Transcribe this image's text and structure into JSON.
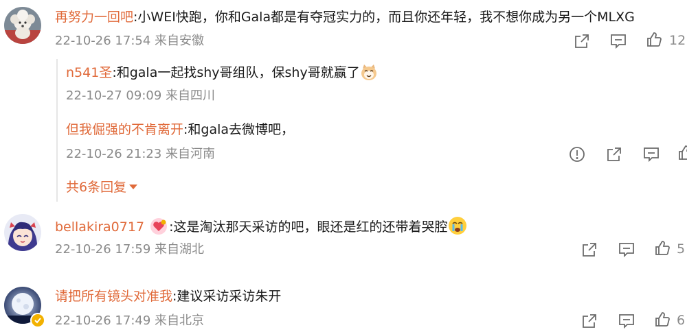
{
  "comments": [
    {
      "user": "再努力一回吧",
      "text": "小WEI快跑，你和Gala都是有夺冠实力的，而且你还年轻，我不想你成为另一个MLXG",
      "date": "22-10-26 17:54",
      "location": "来自安徽",
      "likes": "12",
      "avatar_icon": "poodle-avatar",
      "replies": [
        {
          "user": "n541圣",
          "text": "和gala一起找shy哥组队，保shy哥就赢了",
          "date": "22-10-27 09:09",
          "location": "来自四川",
          "emoji": "cat-emoji"
        },
        {
          "user": "但我倔强的不肯离开",
          "text": "和gala去微博吧，",
          "date": "22-10-26 21:23",
          "location": "来自河南"
        }
      ],
      "more_replies_label": "共6条回复"
    },
    {
      "user": "bellakira0717",
      "text": "这是淘汰那天采访的吧，眼还是红的还带着哭腔",
      "date": "22-10-26 17:59",
      "location": "来自湖北",
      "likes": "5",
      "avatar_icon": "anime-girl-avatar",
      "emoji": "crying-emoji",
      "user_badge": "pink-heart-badge"
    },
    {
      "user": "请把所有镜头对准我",
      "text": "建议采访采访朱开",
      "date": "22-10-26 17:49",
      "location": "来自北京",
      "likes": "6",
      "avatar_icon": "moon-avatar",
      "verified_badge": "verified-gold-badge"
    }
  ],
  "colors": {
    "username": "#e06a3a",
    "meta": "#8a8a8a",
    "text": "#1a1a1a",
    "divider": "#e6e6e6"
  }
}
